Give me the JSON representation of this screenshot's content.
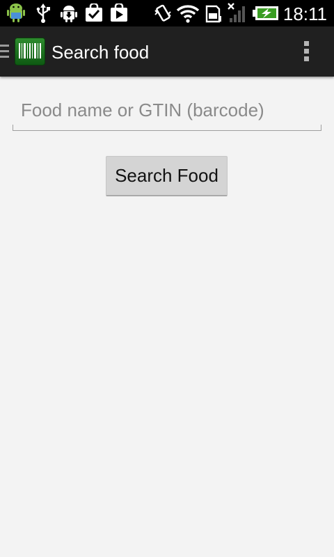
{
  "status_bar": {
    "time": "18:11",
    "left_icons": [
      "android-debug-icon",
      "usb-icon",
      "android-download-icon",
      "check-bag-icon",
      "play-store-icon"
    ],
    "right_icons": [
      "vibrate-icon",
      "wifi-icon",
      "sd-card-icon",
      "no-signal-icon",
      "battery-charging-icon"
    ]
  },
  "action_bar": {
    "title": "Search food",
    "app_icon": "barcode-icon",
    "colors": {
      "background": "#202020",
      "app_icon_green": "#1e7a1e"
    }
  },
  "search": {
    "placeholder": "Food name or GTIN (barcode)",
    "value": "",
    "button_label": "Search Food"
  },
  "colors": {
    "status_bar": "#000000",
    "page_background": "#f3f3f3",
    "button_background": "#d4d4d4"
  }
}
